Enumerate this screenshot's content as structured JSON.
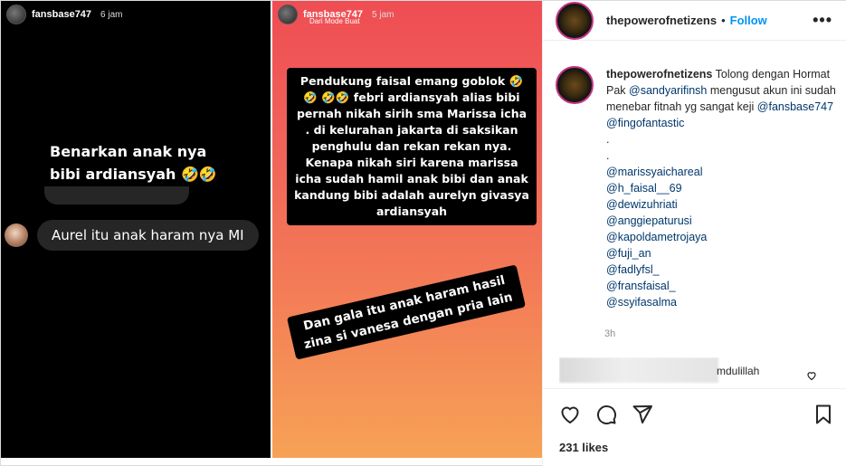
{
  "left_story": {
    "username": "fansbase747",
    "time": "6 jam",
    "caption": "Benarkan anak nya bibi ardiansyah 🤣🤣🤣",
    "chat_message": "Aurel itu anak haram nya MI"
  },
  "right_story": {
    "username": "fansbase747",
    "time": "5 jam",
    "subtitle": "Dari Mode Buat",
    "caption_main": "Pendukung faisal emang goblok 🤣🤣 🤣🤣 febri ardiansyah alias bibi pernah nikah sirih sma Marissa icha . di kelurahan jakarta di saksikan penghulu dan rekan rekan nya. Kenapa nikah siri karena marissa icha sudah hamil anak bibi dan anak kandung bibi adalah aurelyn givasya ardiansyah",
    "caption_slanted": "Dan gala itu anak haram hasil zina si vanesa dengan pria lain"
  },
  "post": {
    "username": "thepowerofnetizens",
    "separator": "•",
    "follow_label": "Follow",
    "more_label": "•••",
    "caption_prefix": "Tolong dengan Hormat Pak",
    "caption_mention1": "@sandyarifinsh",
    "caption_mid": "mengusut akun ini sudah menebar fitnah yg sangat keji",
    "caption_mention2": "@fansbase747",
    "caption_mention3": "@fingofantastic",
    "dot1": ".",
    "dot2": ".",
    "mentions": [
      "@marissyaichareal",
      "@h_faisal__69",
      "@dewizuhriati",
      "@anggiepaturusi",
      "@kapoldametrojaya",
      "@fuji_an",
      "@fadlyfsl_",
      "@fransfaisal_",
      "@ssyifasalma"
    ],
    "time": "3h",
    "comment_text": "mdulillah",
    "likes": "231 likes"
  },
  "icons": {
    "like": "heart-icon",
    "comment": "comment-icon",
    "share": "share-icon",
    "save": "bookmark-icon"
  },
  "colors": {
    "follow": "#0095f6",
    "mention": "#00376b",
    "story_gradient_top": "#ef4d53",
    "story_gradient_bottom": "#f6a256"
  }
}
